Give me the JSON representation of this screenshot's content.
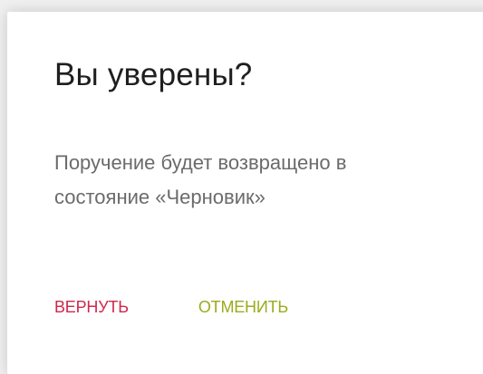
{
  "dialog": {
    "title": "Вы уверены?",
    "message_line1": "Поручение будет возвращено в",
    "message_line2": "состояние «Черновик»",
    "confirm_label": "ВЕРНУТЬ",
    "cancel_label": "ОТМЕНИТЬ"
  },
  "colors": {
    "confirm": "#d0284c",
    "cancel": "#9bab1e",
    "title": "#1f1f1f",
    "message": "#6b6b6b"
  }
}
